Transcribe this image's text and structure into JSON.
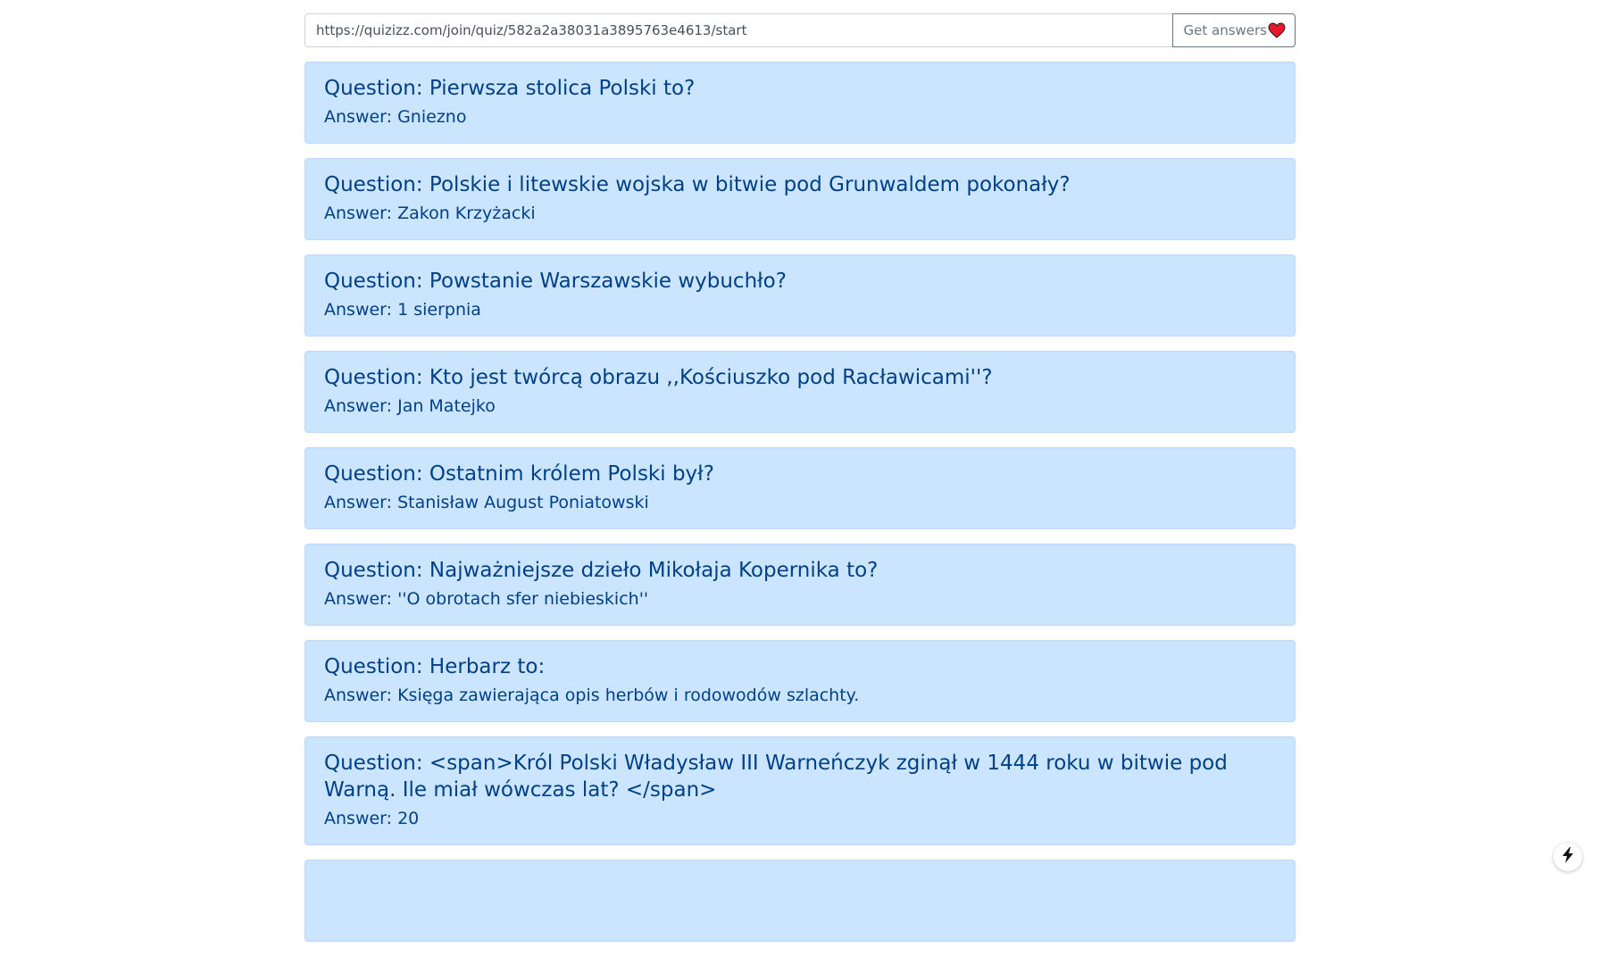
{
  "search": {
    "url_value": "https://quizizz.com/join/quiz/582a2a38031a3895763e4613/start",
    "button_label": "Get answers"
  },
  "cards": [
    {
      "question": "Question: Pierwsza stolica Polski to?",
      "answer": "Answer: Gniezno"
    },
    {
      "question": "Question: Polskie i litewskie wojska w bitwie pod Grunwaldem pokonały?",
      "answer": "Answer: Zakon Krzyżacki"
    },
    {
      "question": "Question: Powstanie Warszawskie wybuchło?",
      "answer": "Answer: 1 sierpnia"
    },
    {
      "question": "Question: Kto jest twórcą obrazu ,,Kościuszko pod Racławicami''?",
      "answer": "Answer: Jan Matejko"
    },
    {
      "question": "Question: Ostatnim królem Polski był?",
      "answer": "Answer: Stanisław August Poniatowski"
    },
    {
      "question": "Question: Najważniejsze dzieło Mikołaja Kopernika to?",
      "answer": "Answer: ''O obrotach sfer niebieskich''"
    },
    {
      "question": "Question: Herbarz to:",
      "answer": "Answer: Księga zawierająca opis herbów i rodowodów szlachty."
    },
    {
      "question": "Question: <span>Król Polski Władysław III Warneńczyk zginął w 1444 roku w bitwie pod Warną. Ile miał wówczas lat? </span>",
      "answer": "Answer: 20"
    },
    {
      "question": "",
      "answer": ""
    }
  ],
  "colors": {
    "card_background": "#cce5ff",
    "card_border": "#b8daff",
    "card_text": "#004085",
    "heart": "#e8192c"
  },
  "icons": {
    "button_icon": "heart-icon",
    "floating_action": "lightning-bolt-icon"
  }
}
